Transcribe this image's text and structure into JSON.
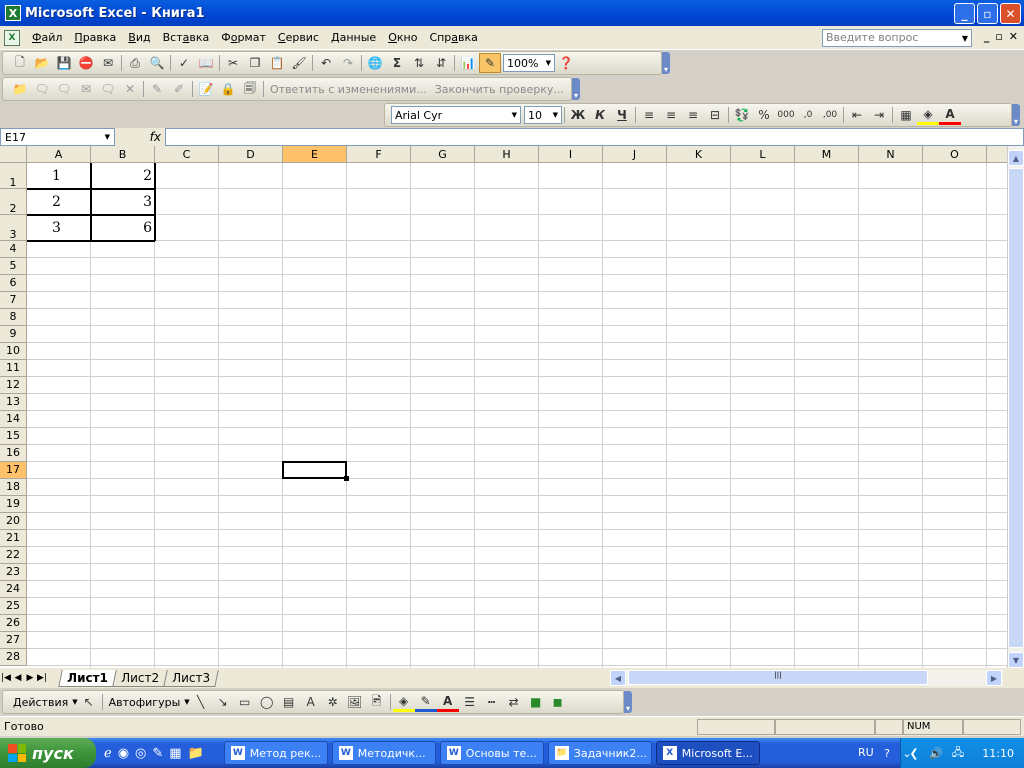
{
  "window": {
    "title": "Microsoft Excel - Книга1",
    "min": "_",
    "max": "▫",
    "close": "✕"
  },
  "menu": {
    "items": [
      {
        "pre": "",
        "ul": "Ф",
        "post": "айл"
      },
      {
        "pre": "",
        "ul": "П",
        "post": "равка"
      },
      {
        "pre": "",
        "ul": "В",
        "post": "ид"
      },
      {
        "pre": "Вст",
        "ul": "а",
        "post": "вка"
      },
      {
        "pre": "Ф",
        "ul": "о",
        "post": "рмат"
      },
      {
        "pre": "",
        "ul": "С",
        "post": "ервис"
      },
      {
        "pre": "",
        "ul": "Д",
        "post": "анные"
      },
      {
        "pre": "",
        "ul": "О",
        "post": "кно"
      },
      {
        "pre": "Спр",
        "ul": "а",
        "post": "вка"
      }
    ],
    "ask_placeholder": "Введите вопрос",
    "doc_min": "_",
    "doc_restore": "▫",
    "doc_close": "✕"
  },
  "toolbar_standard": {
    "zoom": "100%",
    "icons": [
      "new-icon",
      "open-icon",
      "save-icon",
      "permission-icon",
      "email-icon",
      "print-icon",
      "print-preview-icon",
      "spelling-icon",
      "research-icon",
      "cut-icon",
      "copy-icon",
      "paste-icon",
      "format-painter-icon",
      "undo-icon",
      "redo-icon",
      "hyperlink-icon",
      "autosum-icon",
      "sort-asc-icon",
      "sort-desc-icon",
      "chart-wizard-icon",
      "drawing-icon",
      "help-icon"
    ]
  },
  "toolbar_review": {
    "reply_label": "Ответить с изменениями...",
    "end_review_label": "Закончить проверку..."
  },
  "toolbar_format": {
    "font": "Arial Cyr",
    "size": "10",
    "bold": "Ж",
    "italic": "К",
    "underline": "Ч",
    "percent": "%",
    "thousands": "000"
  },
  "formula": {
    "cell_ref": "E17",
    "fx": "fx",
    "value": ""
  },
  "sheet": {
    "columns": [
      "A",
      "B",
      "C",
      "D",
      "E",
      "F",
      "G",
      "H",
      "I",
      "J",
      "K",
      "L",
      "M",
      "N",
      "O"
    ],
    "rows": [
      "1",
      "2",
      "3",
      "4",
      "5",
      "6",
      "7",
      "8",
      "9",
      "10",
      "11",
      "12",
      "13",
      "14",
      "15",
      "16",
      "17",
      "18",
      "19",
      "20",
      "21",
      "22",
      "23",
      "24",
      "25",
      "26",
      "27",
      "28"
    ],
    "active_column": "E",
    "active_row": "17",
    "cells": [
      {
        "ref": "A1",
        "value": "1"
      },
      {
        "ref": "B1",
        "value": "2"
      },
      {
        "ref": "A2",
        "value": "2"
      },
      {
        "ref": "B2",
        "value": "3"
      },
      {
        "ref": "A3",
        "value": "3"
      },
      {
        "ref": "B3",
        "value": "6"
      }
    ],
    "tabs": [
      "Лист1",
      "Лист2",
      "Лист3"
    ],
    "active_tab": "Лист1"
  },
  "drawing": {
    "actions": "Действия",
    "autoshapes": "Автофигуры"
  },
  "status": {
    "text": "Готово",
    "num": "NUM"
  },
  "taskbar": {
    "start": "пуск",
    "tasks": [
      {
        "label": "Метод рек...",
        "icon": "W"
      },
      {
        "label": "Методичк...",
        "icon": "W"
      },
      {
        "label": "Основы те...",
        "icon": "W"
      },
      {
        "label": "Задачник2...",
        "icon": "📁"
      },
      {
        "label": "Microsoft E...",
        "icon": "X"
      }
    ],
    "lang": "RU",
    "clock": "11:10"
  }
}
